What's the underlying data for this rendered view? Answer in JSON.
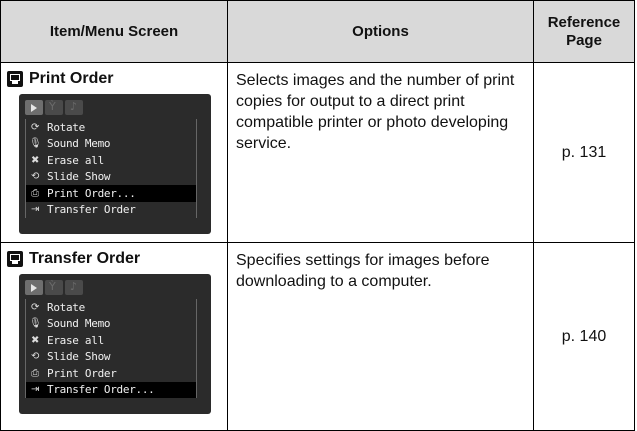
{
  "table": {
    "headers": {
      "item": "Item/Menu Screen",
      "options": "Options",
      "reference_line1": "Reference",
      "reference_line2": "Page"
    },
    "rows": [
      {
        "title": "Print Order",
        "title_icon": "print-order-icon",
        "description": "Selects images and the number of print copies for output to a direct print compatible printer or photo developing service.",
        "page": "p. 131",
        "menu": [
          {
            "icon": "rotate-icon",
            "glyph": "⟳",
            "label": "Rotate",
            "selected": false
          },
          {
            "icon": "microphone-icon",
            "glyph": "🎙",
            "label": "Sound Memo",
            "selected": false
          },
          {
            "icon": "erase-icon",
            "glyph": "✖",
            "label": "Erase all",
            "selected": false
          },
          {
            "icon": "slideshow-icon",
            "glyph": "⟲",
            "label": "Slide Show",
            "selected": false
          },
          {
            "icon": "print-icon",
            "glyph": "⎙",
            "label": "Print Order...",
            "selected": true
          },
          {
            "icon": "transfer-icon",
            "glyph": "⇥",
            "label": "Transfer Order",
            "selected": false
          }
        ]
      },
      {
        "title": "Transfer Order",
        "title_icon": "transfer-order-icon",
        "description": "Specifies settings for images before downloading to a computer.",
        "page": "p. 140",
        "menu": [
          {
            "icon": "rotate-icon",
            "glyph": "⟳",
            "label": "Rotate",
            "selected": false
          },
          {
            "icon": "microphone-icon",
            "glyph": "🎙",
            "label": "Sound Memo",
            "selected": false
          },
          {
            "icon": "erase-icon",
            "glyph": "✖",
            "label": "Erase all",
            "selected": false
          },
          {
            "icon": "slideshow-icon",
            "glyph": "⟲",
            "label": "Slide Show",
            "selected": false
          },
          {
            "icon": "print-icon",
            "glyph": "⎙",
            "label": "Print Order",
            "selected": false
          },
          {
            "icon": "transfer-icon",
            "glyph": "⇥",
            "label": "Transfer Order...",
            "selected": true
          }
        ]
      }
    ]
  }
}
